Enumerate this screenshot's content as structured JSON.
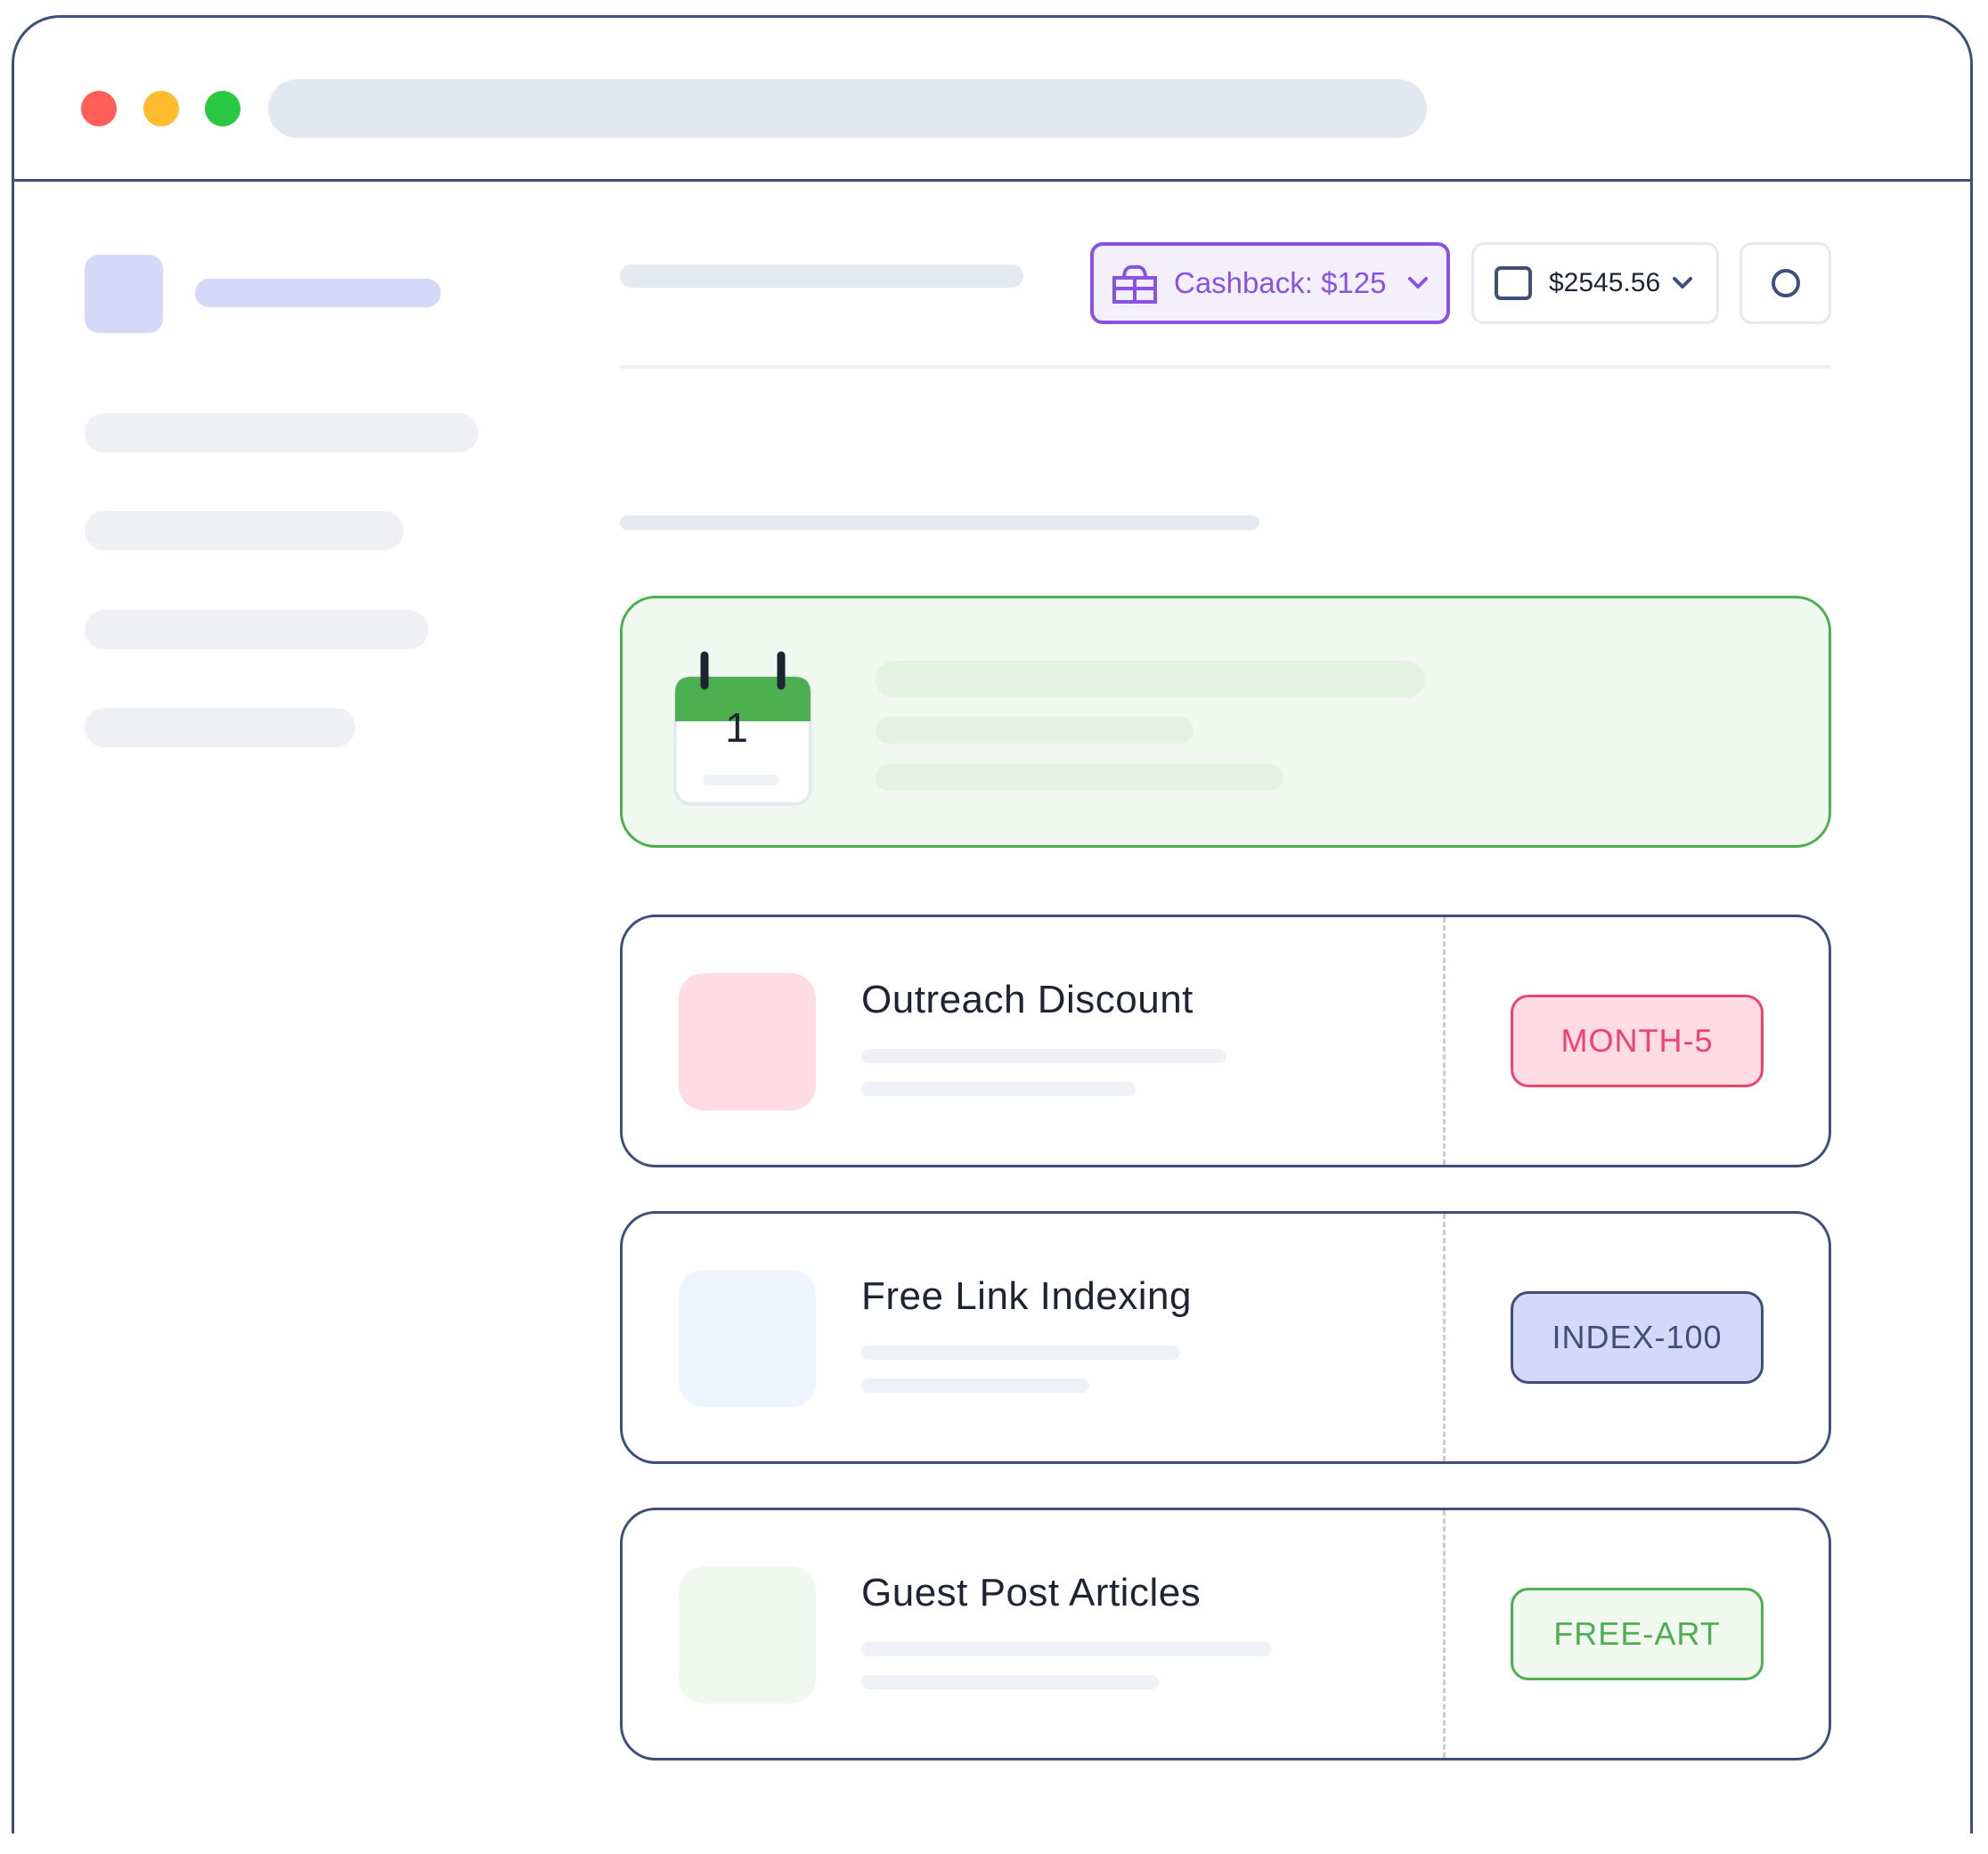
{
  "window": {
    "controls": [
      "close",
      "minimize",
      "maximize"
    ]
  },
  "header": {
    "cashback_label": "Cashback: $125",
    "balance_label": "$2545.56",
    "icons": {
      "cashback": "gift-icon",
      "balance": "wallet-icon",
      "user": "user-avatar-icon",
      "dropdown": "chevron-down-icon"
    }
  },
  "promo": {
    "calendar_day": "1",
    "accent": "#4caf50"
  },
  "offers": [
    {
      "title": "Outreach Discount",
      "code": "MONTH-5",
      "color": "#f0426e",
      "bg": "#ffdbe3"
    },
    {
      "title": "Free Link Indexing",
      "code": "INDEX-100",
      "color": "#3f4f7a",
      "bg": "#d4d9f9"
    },
    {
      "title": "Guest Post Articles",
      "code": "FREE-ART",
      "color": "#4caf50",
      "bg": "#f1f8f0"
    }
  ],
  "colors": {
    "window_border": "#3f4f7a",
    "cashback_accent": "#8a52e3",
    "skeleton": "#eff0f4"
  }
}
